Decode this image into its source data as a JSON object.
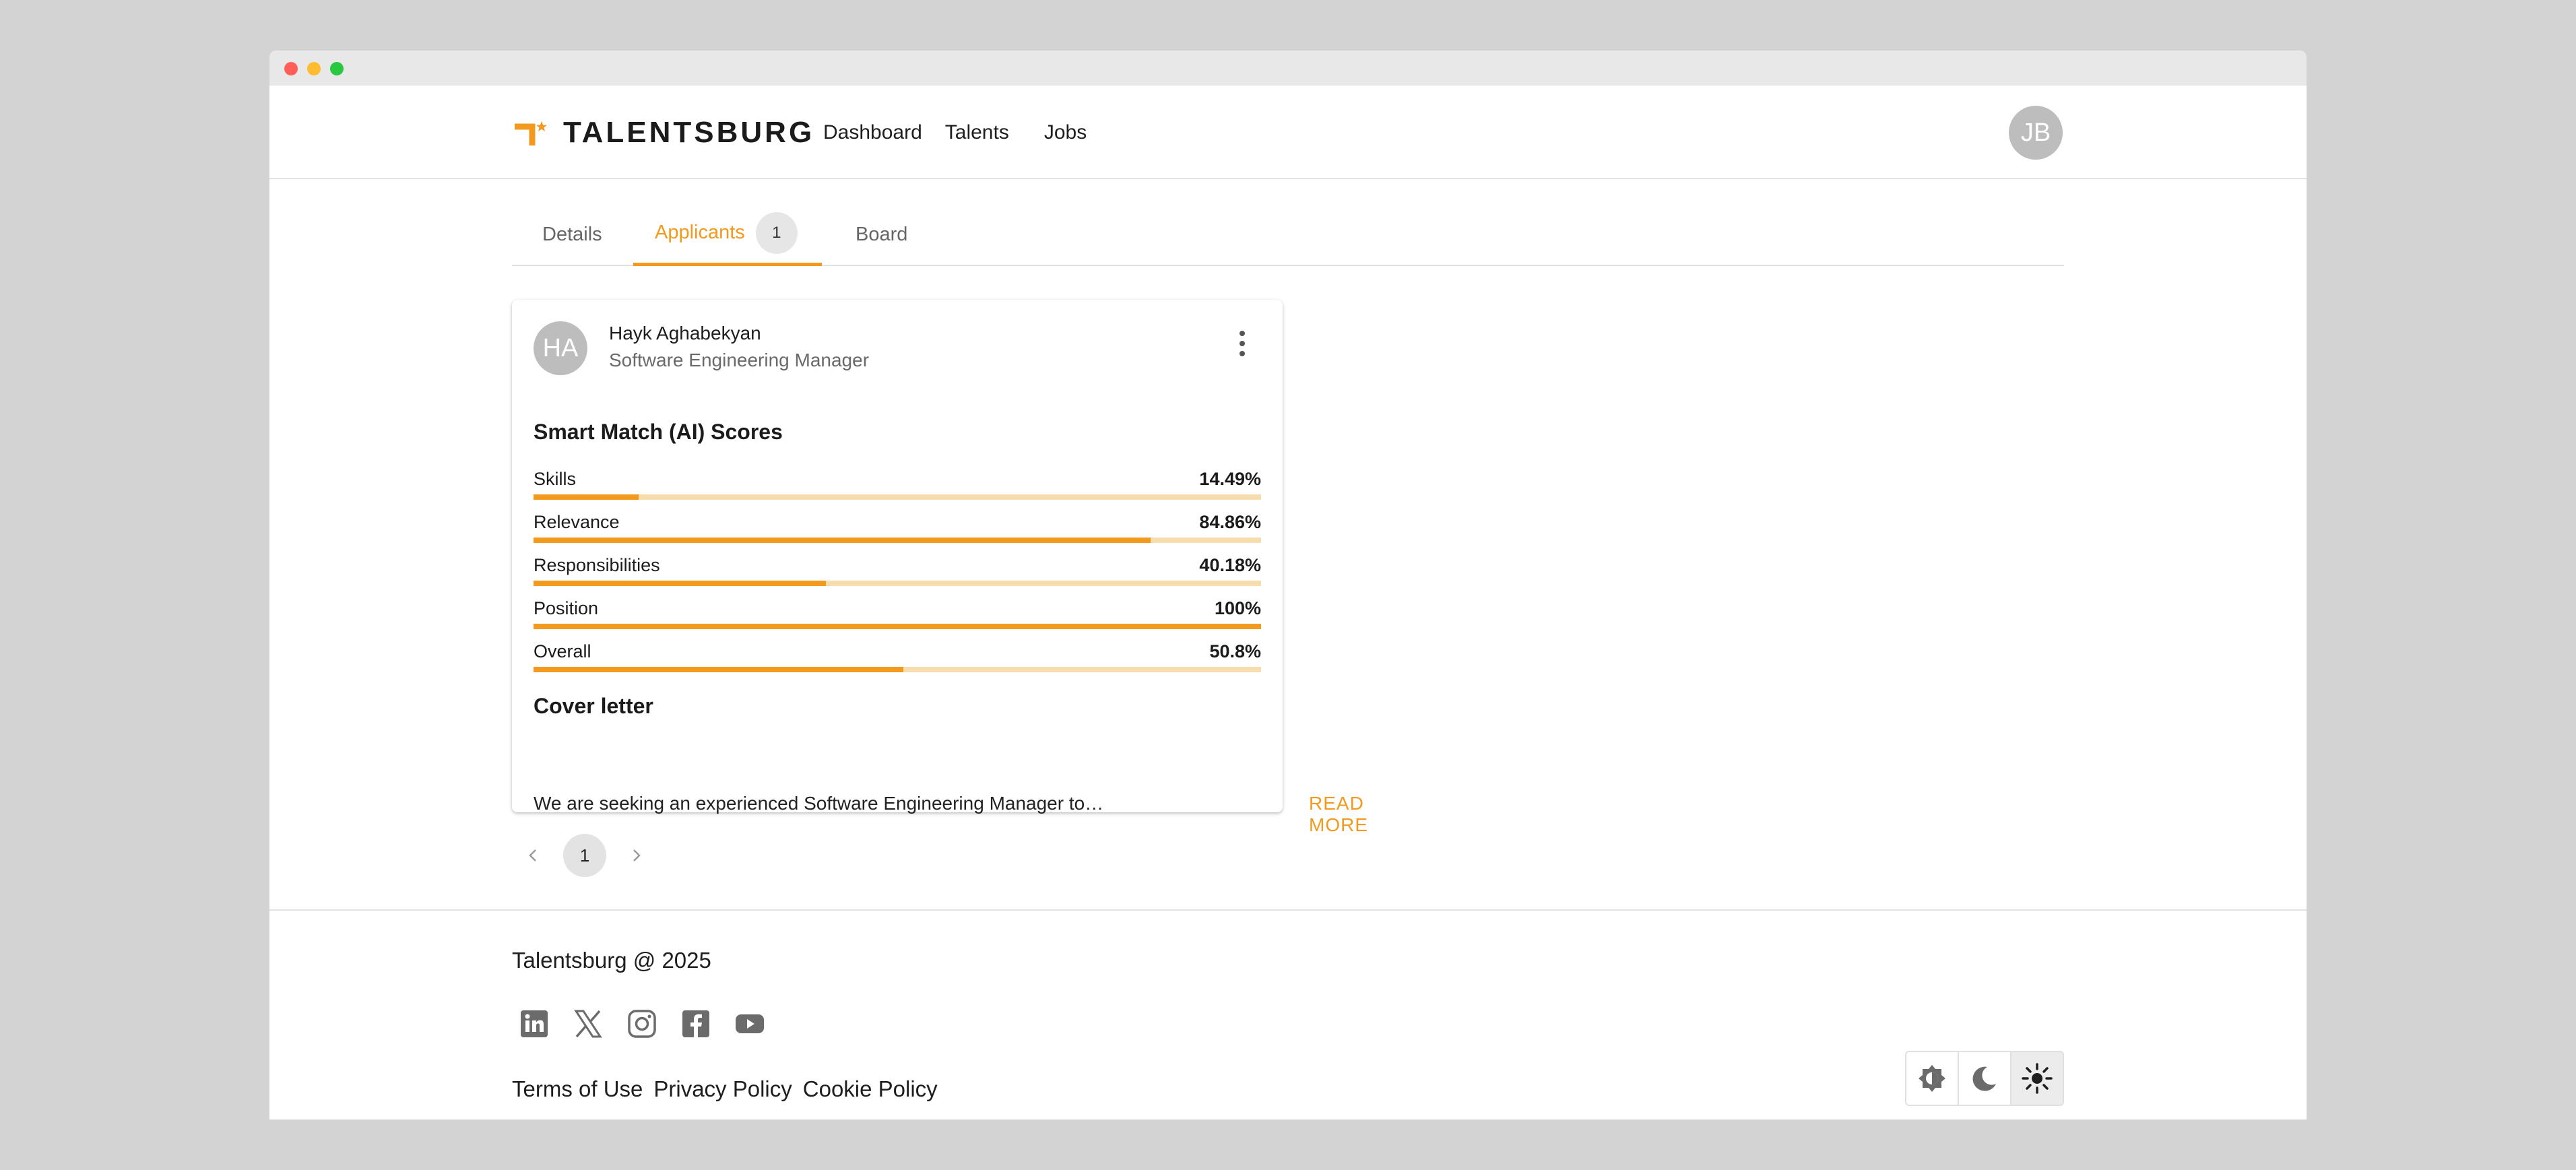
{
  "brand": {
    "name": "TALENTSBURG",
    "accent": "#f39a1e"
  },
  "nav": {
    "dashboard": "Dashboard",
    "talents": "Talents",
    "jobs": "Jobs"
  },
  "user": {
    "initials": "JB"
  },
  "tabs": {
    "details": "Details",
    "applicants": "Applicants",
    "applicants_count": "1",
    "board": "Board"
  },
  "applicant": {
    "initials": "HA",
    "name": "Hayk Aghabekyan",
    "title": "Software Engineering Manager",
    "scores_title": "Smart Match (AI) Scores",
    "scores": [
      {
        "label": "Skills",
        "value": "14.49%",
        "fraction": 0.1449
      },
      {
        "label": "Relevance",
        "value": "84.86%",
        "fraction": 0.8486
      },
      {
        "label": "Responsibilities",
        "value": "40.18%",
        "fraction": 0.4018
      },
      {
        "label": "Position",
        "value": "100%",
        "fraction": 1.0
      },
      {
        "label": "Overall",
        "value": "50.8%",
        "fraction": 0.508
      }
    ],
    "cover_title": "Cover letter",
    "cover_excerpt": "We are seeking an experienced Software Engineering Manager to…",
    "read_more": "READ MORE"
  },
  "pagination": {
    "current": "1",
    "prev_icon": "chevron-left-icon",
    "next_icon": "chevron-right-icon"
  },
  "footer": {
    "copyright": "Talentsburg @ 2025",
    "socials": [
      "linkedin-icon",
      "x-icon",
      "instagram-icon",
      "facebook-icon",
      "youtube-icon"
    ],
    "links": {
      "terms": "Terms of Use",
      "privacy": "Privacy Policy",
      "cookie": "Cookie Policy"
    },
    "theme_modes": [
      "auto-contrast-icon",
      "moon-icon",
      "sun-icon"
    ],
    "theme_selected": "sun-icon"
  }
}
